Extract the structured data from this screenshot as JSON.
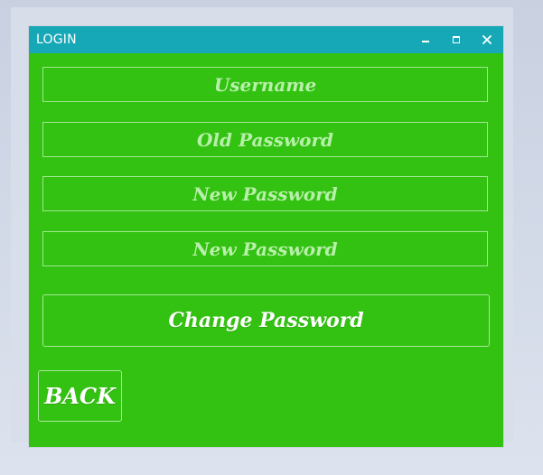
{
  "window": {
    "title": "LOGIN",
    "colors": {
      "titlebar": "#17a8b8",
      "background": "#33c212",
      "border": "#9ee78e",
      "text": "#ffffff",
      "placeholder": "#b8f0aa"
    },
    "controls": {
      "minimize_icon": "minimize-icon",
      "maximize_icon": "maximize-icon",
      "close_icon": "close-icon"
    }
  },
  "form": {
    "fields": [
      {
        "name": "username",
        "placeholder": "Username",
        "value": ""
      },
      {
        "name": "old_password",
        "placeholder": "Old Password",
        "value": ""
      },
      {
        "name": "new_password",
        "placeholder": "New Password",
        "value": ""
      },
      {
        "name": "new_password_confirm",
        "placeholder": "New Password",
        "value": ""
      }
    ],
    "change_password_label": "Change Password",
    "back_label": "BACK"
  }
}
